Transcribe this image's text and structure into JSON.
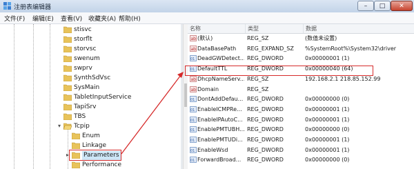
{
  "window": {
    "title": "注册表编辑器",
    "min_label": "–",
    "max_label": "□",
    "close_label": "✕"
  },
  "menu": [
    "文件(F)",
    "编辑(E)",
    "查看(V)",
    "收藏夹(A)",
    "帮助(H)"
  ],
  "tree": {
    "items": [
      {
        "label": "stisvc"
      },
      {
        "label": "storflt"
      },
      {
        "label": "storvsc"
      },
      {
        "label": "swenum"
      },
      {
        "label": "swprv"
      },
      {
        "label": "SynthSdVsc"
      },
      {
        "label": "SysMain"
      },
      {
        "label": "TabletInputService"
      },
      {
        "label": "TapiSrv"
      },
      {
        "label": "TBS"
      },
      {
        "label": "Tcpip"
      },
      {
        "label": "Enum"
      },
      {
        "label": "Linkage"
      },
      {
        "label": "Parameters"
      },
      {
        "label": "Performance"
      }
    ]
  },
  "columns": {
    "name": "名称",
    "type": "类型",
    "data": "数据"
  },
  "values": [
    {
      "name": "(默认)",
      "type": "REG_SZ",
      "data": "(数值未设置)"
    },
    {
      "name": "DataBasePath",
      "type": "REG_EXPAND_SZ",
      "data": "%SystemRoot%\\System32\\driver"
    },
    {
      "name": "DeadGWDetect...",
      "type": "REG_DWORD",
      "data": "0x00000001 (1)"
    },
    {
      "name": "DefaultTTL",
      "type": "REG_DWORD",
      "data": "0x00000040 (64)"
    },
    {
      "name": "DhcpNameServ...",
      "type": "REG_SZ",
      "data": "192.168.2.1 218.85.152.99"
    },
    {
      "name": "Domain",
      "type": "REG_SZ",
      "data": ""
    },
    {
      "name": "DontAddDefau...",
      "type": "REG_DWORD",
      "data": "0x00000000 (0)"
    },
    {
      "name": "EnableICMPRe...",
      "type": "REG_DWORD",
      "data": "0x00000001 (1)"
    },
    {
      "name": "EnableIPAutoC...",
      "type": "REG_DWORD",
      "data": "0x00000001 (1)"
    },
    {
      "name": "EnablePMTUBH...",
      "type": "REG_DWORD",
      "data": "0x00000000 (0)"
    },
    {
      "name": "EnablePMTUDi...",
      "type": "REG_DWORD",
      "data": "0x00000001 (1)"
    },
    {
      "name": "EnableWsd",
      "type": "REG_DWORD",
      "data": "0x00000001 (1)"
    },
    {
      "name": "ForwardBroad...",
      "type": "REG_DWORD",
      "data": "0x00000000 (0)"
    }
  ],
  "colors": {
    "highlight": "#d62a2a",
    "folder": "#e8c35a",
    "selection": "#cde6f7"
  }
}
